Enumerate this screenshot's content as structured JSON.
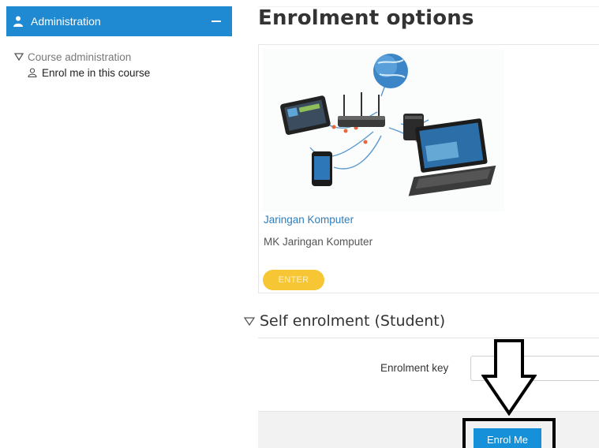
{
  "sidebar": {
    "header": {
      "title": "Administration"
    },
    "tree": {
      "parent_label": "Course administration",
      "child_label": "Enrol me in this course"
    }
  },
  "main": {
    "page_title": "Enrolment options",
    "course": {
      "name": "Jaringan Komputer",
      "summary": "MK Jaringan Komputer",
      "enter_label": "ENTER"
    },
    "self_enrolment": {
      "title": "Self enrolment (Student)",
      "key_label": "Enrolment key",
      "key_value": "",
      "submit_label": "Enrol Me"
    }
  },
  "colors": {
    "accent": "#1f8ad2",
    "link": "#2b7ec1",
    "enter_button": "#f7c634",
    "submit_button": "#1690d8"
  },
  "icons": [
    "person-icon",
    "minus-icon",
    "triangle-down-icon",
    "user-outline-icon",
    "network-devices-image",
    "annotation-down-arrow"
  ]
}
